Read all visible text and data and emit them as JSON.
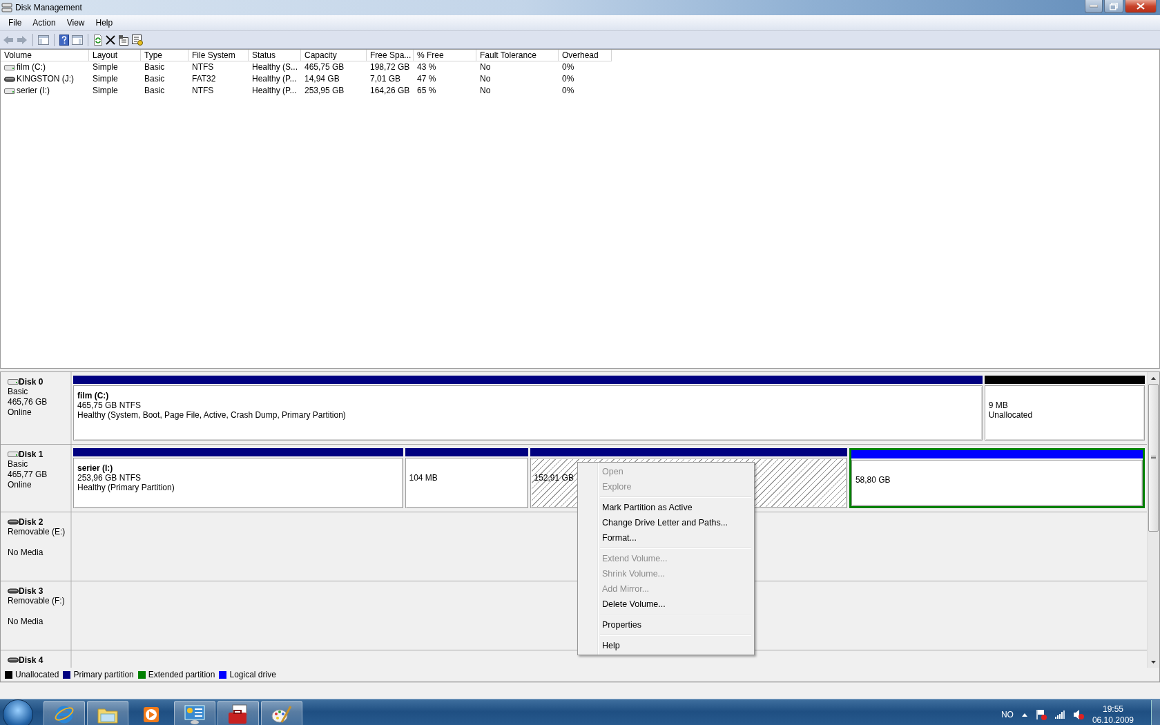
{
  "window": {
    "title": "Disk Management"
  },
  "menu": [
    "File",
    "Action",
    "View",
    "Help"
  ],
  "table": {
    "columns": [
      "Volume",
      "Layout",
      "Type",
      "File System",
      "Status",
      "Capacity",
      "Free Spa...",
      "% Free",
      "Fault Tolerance",
      "Overhead"
    ],
    "rows": [
      {
        "kind": "fixed",
        "cells": [
          "film (C:)",
          "Simple",
          "Basic",
          "NTFS",
          "Healthy (S...",
          "465,75 GB",
          "198,72 GB",
          "43 %",
          "No",
          "0%"
        ]
      },
      {
        "kind": "removable",
        "cells": [
          "KINGSTON (J:)",
          "Simple",
          "Basic",
          "FAT32",
          "Healthy (P...",
          "14,94 GB",
          "7,01 GB",
          "47 %",
          "No",
          "0%"
        ]
      },
      {
        "kind": "fixed",
        "cells": [
          "serier (I:)",
          "Simple",
          "Basic",
          "NTFS",
          "Healthy (P...",
          "253,95 GB",
          "164,26 GB",
          "65 %",
          "No",
          "0%"
        ]
      }
    ]
  },
  "disks": [
    {
      "name": "Disk 0",
      "kind": "fixed",
      "type": "Basic",
      "size": "465,76 GB",
      "status": "Online",
      "partitions": [
        {
          "kind": "primary",
          "name": "film  (C:)",
          "size": "465,75 GB NTFS",
          "status": "Healthy (System, Boot, Page File, Active, Crash Dump, Primary Partition)",
          "selected": false,
          "extended": false
        },
        {
          "kind": "unallocated",
          "size": "9 MB",
          "status": "Unallocated",
          "selected": false,
          "extended": false
        }
      ]
    },
    {
      "name": "Disk 1",
      "kind": "fixed",
      "type": "Basic",
      "size": "465,77 GB",
      "status": "Online",
      "partitions": [
        {
          "kind": "primary",
          "name": "serier  (I:)",
          "size": "253,96 GB NTFS",
          "status": "Healthy (Primary Partition)",
          "selected": false,
          "extended": false
        },
        {
          "kind": "primary",
          "size": "104 MB",
          "selected": false,
          "extended": false
        },
        {
          "kind": "primary",
          "size": "152,91 GB",
          "selected": true,
          "extended": false
        },
        {
          "kind": "logical",
          "size": "58,80 GB",
          "selected": false,
          "extended": true
        }
      ]
    },
    {
      "name": "Disk 2",
      "kind": "removable",
      "type": "Removable (E:)",
      "status": "No Media"
    },
    {
      "name": "Disk 3",
      "kind": "removable",
      "type": "Removable (F:)",
      "status": "No Media"
    },
    {
      "name": "Disk 4",
      "kind": "removable"
    }
  ],
  "legend": [
    {
      "label": "Unallocated",
      "color": "#000000"
    },
    {
      "label": "Primary partition",
      "color": "#000080"
    },
    {
      "label": "Extended partition",
      "color": "#008000"
    },
    {
      "label": "Logical drive",
      "color": "#0000ff"
    }
  ],
  "context_menu": [
    [
      {
        "label": "Open",
        "disabled": true
      },
      {
        "label": "Explore",
        "disabled": true
      }
    ],
    [
      {
        "label": "Mark Partition as Active",
        "disabled": false
      },
      {
        "label": "Change Drive Letter and Paths...",
        "disabled": false
      },
      {
        "label": "Format...",
        "disabled": false
      }
    ],
    [
      {
        "label": "Extend Volume...",
        "disabled": true
      },
      {
        "label": "Shrink Volume...",
        "disabled": true
      },
      {
        "label": "Add Mirror...",
        "disabled": true
      },
      {
        "label": "Delete Volume...",
        "disabled": false
      }
    ],
    [
      {
        "label": "Properties",
        "disabled": false
      }
    ],
    [
      {
        "label": "Help",
        "disabled": false
      }
    ]
  ],
  "taskbar": {
    "language": "NO",
    "time": "19:55",
    "date": "06.10.2009"
  }
}
